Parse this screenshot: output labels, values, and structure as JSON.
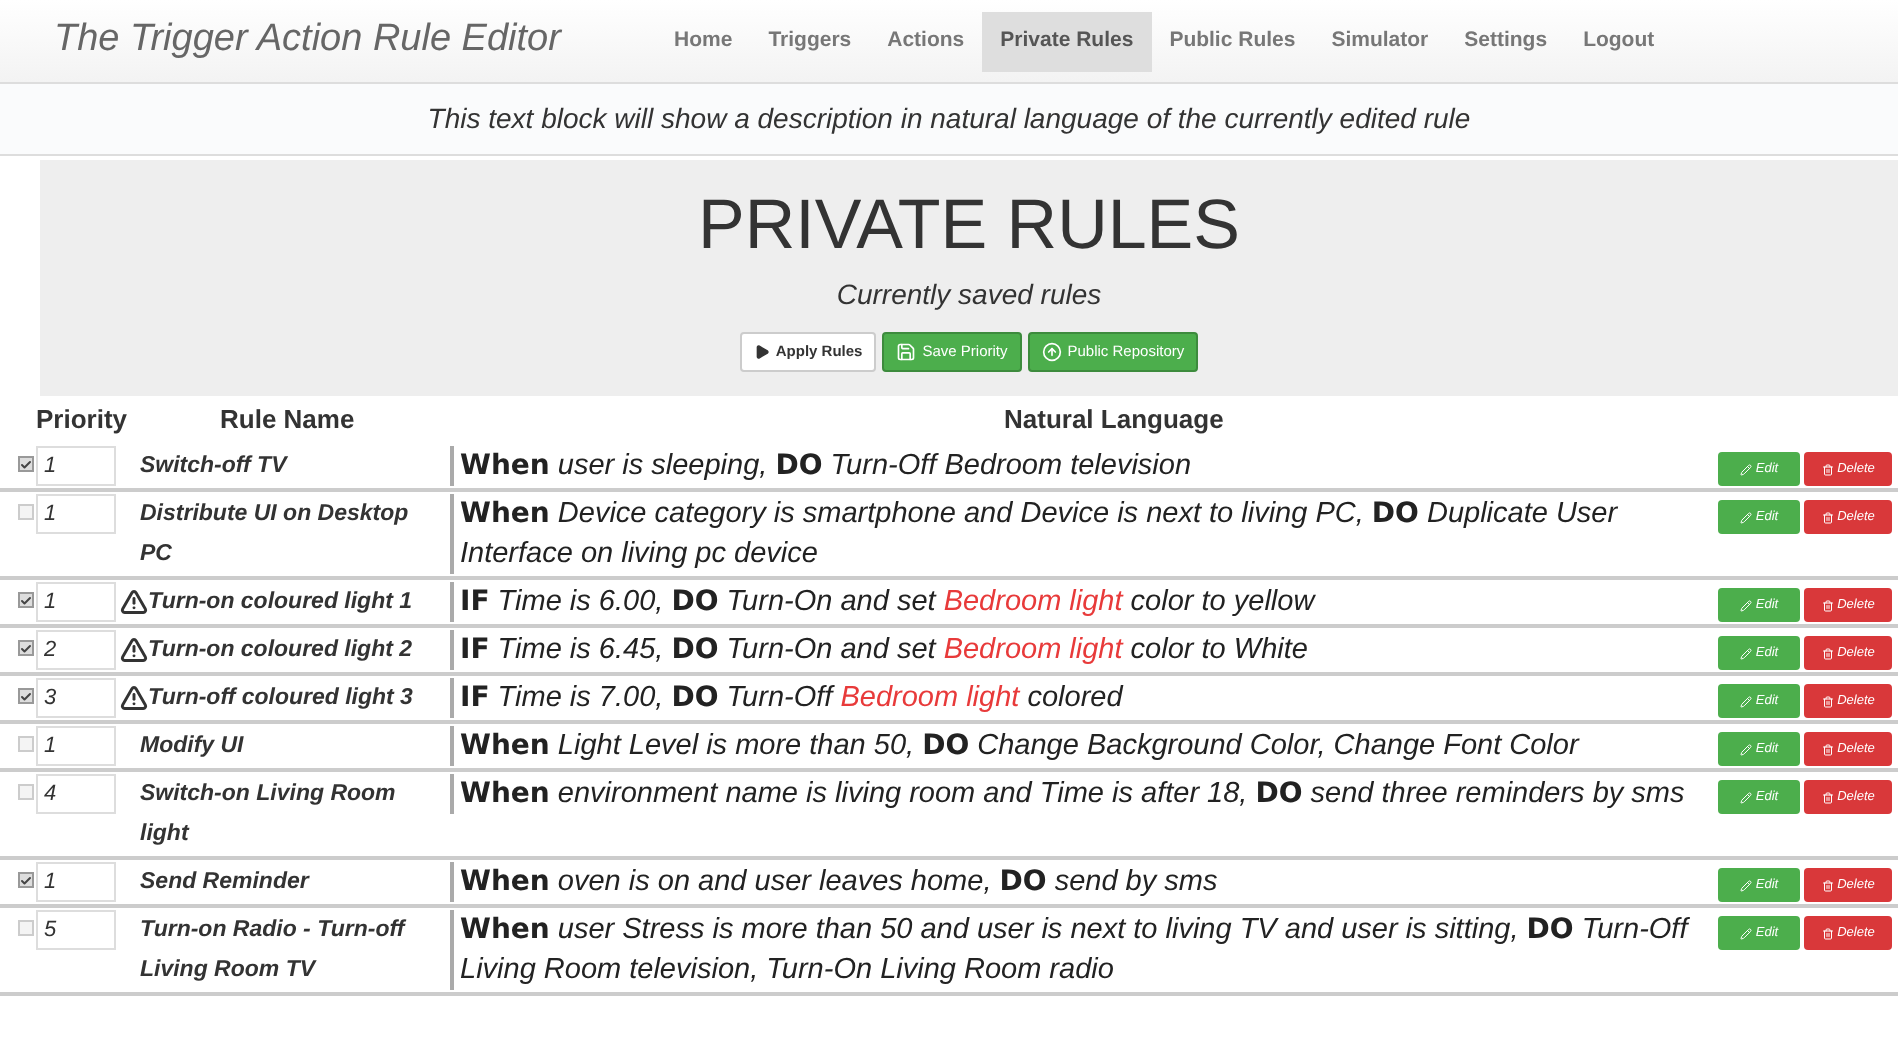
{
  "app_title": "The Trigger Action Rule Editor",
  "nav": [
    {
      "label": "Home",
      "selected": false
    },
    {
      "label": "Triggers",
      "selected": false
    },
    {
      "label": "Actions",
      "selected": false
    },
    {
      "label": "Private Rules",
      "selected": true
    },
    {
      "label": "Public Rules",
      "selected": false
    },
    {
      "label": "Simulator",
      "selected": false
    },
    {
      "label": "Settings",
      "selected": false
    },
    {
      "label": "Logout",
      "selected": false
    }
  ],
  "description": "This text block will show a description in natural language of the currently edited rule",
  "heading": "PRIVATE RULES",
  "subheading": "Currently saved rules",
  "actions": [
    {
      "label": "Apply Rules",
      "kind": "apply"
    },
    {
      "label": "Save Priority",
      "kind": "save"
    },
    {
      "label": "Public Repository",
      "kind": "repository"
    }
  ],
  "columns": [
    "Priority",
    "Rule Name",
    "Natural Language"
  ],
  "rows": [
    {
      "checked": true,
      "priority": "1",
      "warning": false,
      "name": "Switch-off TV",
      "language": [
        {
          "kind": "keyword",
          "text": "When"
        },
        {
          "kind": "text",
          "text": " user is sleeping, "
        },
        {
          "kind": "keyword",
          "text": "DO"
        },
        {
          "kind": "text",
          "text": " Turn-Off Bedroom television"
        }
      ],
      "edit": "Edit",
      "delete": "Delete"
    },
    {
      "checked": false,
      "priority": "1",
      "warning": false,
      "name": "Distribute UI on Desktop PC",
      "language": [
        {
          "kind": "keyword",
          "text": "When"
        },
        {
          "kind": "text",
          "text": " Device category is smartphone and Device is next to living PC, "
        },
        {
          "kind": "keyword",
          "text": "DO"
        },
        {
          "kind": "text",
          "text": " Duplicate User Interface on living pc device"
        }
      ],
      "edit": "Edit",
      "delete": "Delete"
    },
    {
      "checked": true,
      "priority": "1",
      "warning": true,
      "name": "Turn-on coloured light 1",
      "language": [
        {
          "kind": "keyword",
          "text": "IF"
        },
        {
          "kind": "text",
          "text": " Time is 6.00, "
        },
        {
          "kind": "keyword",
          "text": "DO"
        },
        {
          "kind": "text",
          "text": " Turn-On and set "
        },
        {
          "kind": "device",
          "text": "Bedroom light"
        },
        {
          "kind": "text",
          "text": " color to yellow"
        }
      ],
      "edit": "Edit",
      "delete": "Delete"
    },
    {
      "checked": true,
      "priority": "2",
      "warning": true,
      "name": "Turn-on coloured light 2",
      "language": [
        {
          "kind": "keyword",
          "text": "IF"
        },
        {
          "kind": "text",
          "text": " Time is 6.45, "
        },
        {
          "kind": "keyword",
          "text": "DO"
        },
        {
          "kind": "text",
          "text": " Turn-On and set "
        },
        {
          "kind": "device",
          "text": "Bedroom light"
        },
        {
          "kind": "text",
          "text": " color to White"
        }
      ],
      "edit": "Edit",
      "delete": "Delete"
    },
    {
      "checked": true,
      "priority": "3",
      "warning": true,
      "name": "Turn-off coloured light 3",
      "language": [
        {
          "kind": "keyword",
          "text": "IF"
        },
        {
          "kind": "text",
          "text": " Time is 7.00, "
        },
        {
          "kind": "keyword",
          "text": "DO"
        },
        {
          "kind": "text",
          "text": " Turn-Off "
        },
        {
          "kind": "device",
          "text": "Bedroom light"
        },
        {
          "kind": "text",
          "text": " colored"
        }
      ],
      "edit": "Edit",
      "delete": "Delete"
    },
    {
      "checked": false,
      "priority": "1",
      "warning": false,
      "name": "Modify UI",
      "language": [
        {
          "kind": "keyword",
          "text": "When"
        },
        {
          "kind": "text",
          "text": " Light Level is more than 50, "
        },
        {
          "kind": "keyword",
          "text": "DO"
        },
        {
          "kind": "text",
          "text": " Change Background Color, Change Font Color"
        }
      ],
      "edit": "Edit",
      "delete": "Delete"
    },
    {
      "checked": false,
      "priority": "4",
      "warning": false,
      "name": "Switch-on Living Room light",
      "language": [
        {
          "kind": "keyword",
          "text": "When"
        },
        {
          "kind": "text",
          "text": " environment name is living room and Time is after 18, "
        },
        {
          "kind": "keyword",
          "text": "DO"
        },
        {
          "kind": "text",
          "text": " send three reminders by sms"
        }
      ],
      "edit": "Edit",
      "delete": "Delete"
    },
    {
      "checked": true,
      "priority": "1",
      "warning": false,
      "name": "Send Reminder",
      "language": [
        {
          "kind": "keyword",
          "text": "When"
        },
        {
          "kind": "text",
          "text": " oven is on and user leaves home, "
        },
        {
          "kind": "keyword",
          "text": "DO"
        },
        {
          "kind": "text",
          "text": " send by sms"
        }
      ],
      "edit": "Edit",
      "delete": "Delete"
    },
    {
      "checked": false,
      "priority": "5",
      "warning": false,
      "name": "Turn-on Radio - Turn-off Living Room TV",
      "language": [
        {
          "kind": "keyword",
          "text": "When"
        },
        {
          "kind": "text",
          "text": " user Stress is more than 50 and user is next to living TV and user is sitting, "
        },
        {
          "kind": "keyword",
          "text": "DO"
        },
        {
          "kind": "text",
          "text": " Turn-Off Living Room television, Turn-On Living Room radio"
        }
      ],
      "edit": "Edit",
      "delete": "Delete"
    }
  ]
}
